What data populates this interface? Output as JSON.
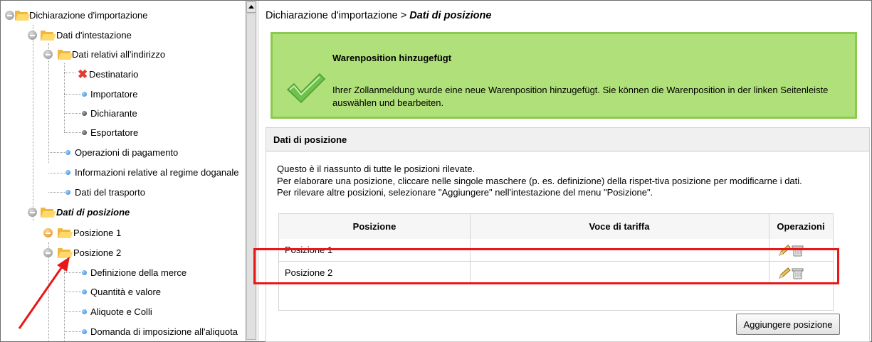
{
  "tree": {
    "items": [
      {
        "label": "Dichiarazione d'importazione"
      },
      {
        "label": "Dati d'intestazione"
      },
      {
        "label": "Dati relativi all'indirizzo"
      },
      {
        "label": "Destinatario"
      },
      {
        "label": "Importatore"
      },
      {
        "label": "Dichiarante"
      },
      {
        "label": "Esportatore"
      },
      {
        "label": "Operazioni di pagamento"
      },
      {
        "label": "Informazioni relative al regime doganale"
      },
      {
        "label": "Dati del trasporto"
      },
      {
        "label": "Dati di posizione"
      },
      {
        "label": "Posizione 1"
      },
      {
        "label": "Posizione 2"
      },
      {
        "label": "Definizione della merce"
      },
      {
        "label": "Quantità e valore"
      },
      {
        "label": "Aliquote e Colli"
      },
      {
        "label": "Domanda di imposizione all'aliquota"
      }
    ]
  },
  "breadcrumb": {
    "parent": "Dichiarazione d'importazione",
    "separator": ">",
    "current": "Dati di posizione"
  },
  "notification": {
    "title": "Warenposition hinzugefügt",
    "message": "Ihrer Zollanmeldung wurde eine neue Warenposition hinzugefügt. Sie können die Warenposition in der linken Seitenleiste auswählen und bearbeiten.",
    "color": "#b0e079"
  },
  "section": {
    "title": "Dati di posizione",
    "lines": [
      "Questo è il riassunto di tutte le posizioni rilevate.",
      "Per elaborare una posizione, cliccare nelle singole maschere (p. es. definizione) della rispet-tiva posizione per modificarne i dati.",
      "Per rilevare altre posizioni, selezionare \"Aggiungere\" nell'intestazione del menu \"Posizione\"."
    ]
  },
  "table": {
    "headers": [
      "Posizione",
      "Voce di tariffa",
      "Operazioni"
    ],
    "rows": [
      {
        "posizione": "Posizione 1",
        "voce": ""
      },
      {
        "posizione": "Posizione 2",
        "voce": ""
      }
    ]
  },
  "add_button": "Aggiungere posizione",
  "annotation_color": "#e81818"
}
